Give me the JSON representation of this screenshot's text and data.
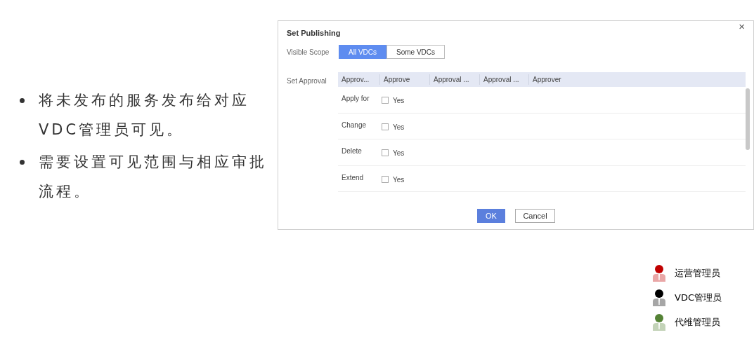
{
  "bullets": [
    "将未发布的服务发布给对应VDC管理员可见。",
    "需要设置可见范围与相应审批流程。"
  ],
  "dialog": {
    "title": "Set Publishing",
    "close": "×",
    "visible_scope": {
      "label": "Visible Scope",
      "options": [
        {
          "label": "All VDCs",
          "selected": true
        },
        {
          "label": "Some VDCs",
          "selected": false
        }
      ]
    },
    "approval": {
      "label": "Set Approval",
      "columns": [
        "Approv...",
        "Approve",
        "Approval ...",
        "Approval ...",
        "Approver"
      ],
      "rows": [
        {
          "action": "Apply for",
          "checked": false,
          "option": "Yes"
        },
        {
          "action": "Change",
          "checked": false,
          "option": "Yes"
        },
        {
          "action": "Delete",
          "checked": false,
          "option": "Yes"
        },
        {
          "action": "Extend",
          "checked": false,
          "option": "Yes"
        }
      ]
    },
    "buttons": [
      {
        "label": "OK",
        "kind": "primary"
      },
      {
        "label": "Cancel",
        "kind": "secondary"
      }
    ]
  },
  "legend": [
    {
      "label": "运营管理员",
      "color": "#c00000"
    },
    {
      "label": "VDC管理员",
      "color": "#000000"
    },
    {
      "label": "代维管理员",
      "color": "#548235"
    }
  ]
}
